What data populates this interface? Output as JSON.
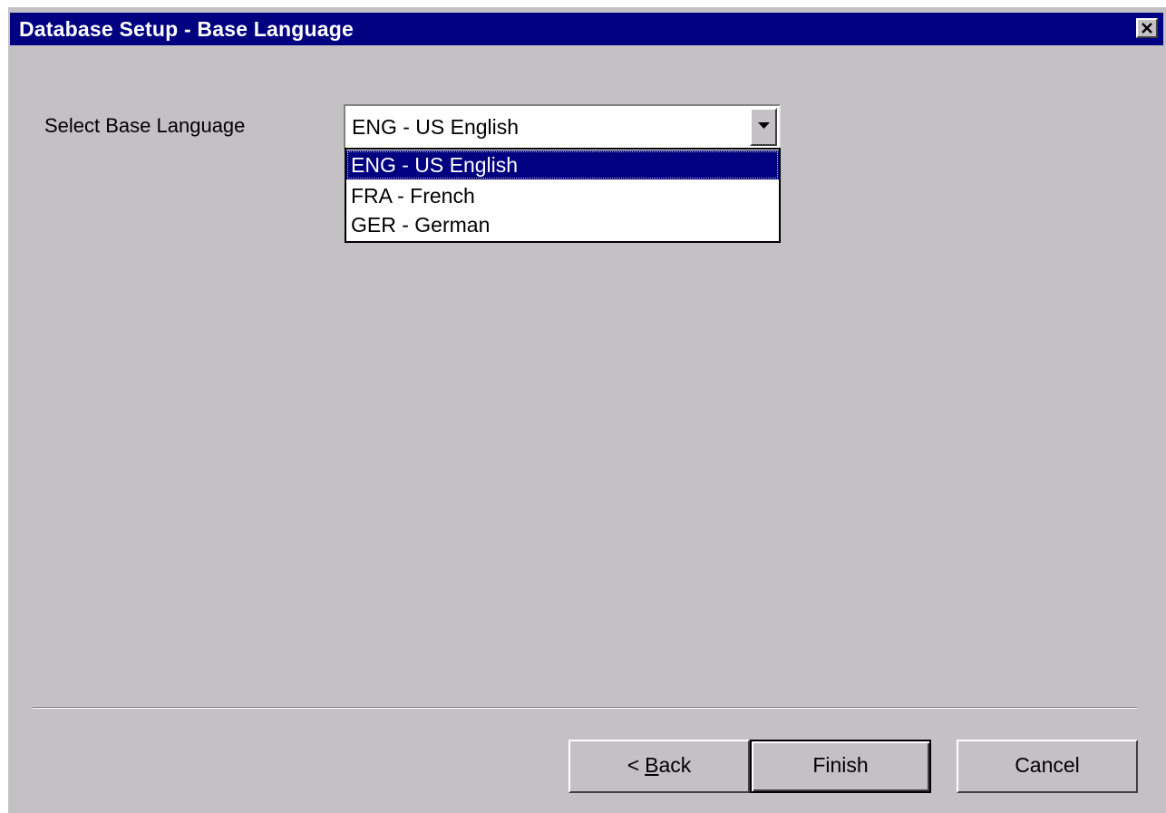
{
  "window": {
    "title": "Database Setup - Base Language",
    "close_icon": "close-icon"
  },
  "form": {
    "language_label": "Select Base Language",
    "language_combo": {
      "selected_value": "ENG - US English",
      "options": [
        "ENG - US English",
        "FRA - French",
        "GER - German"
      ],
      "highlighted_index": 0,
      "expanded": true
    }
  },
  "buttons": {
    "back_prefix": "<",
    "back_mnemonic": "B",
    "back_rest": "ack",
    "finish_label": "Finish",
    "cancel_label": "Cancel"
  },
  "colors": {
    "titlebar": "#000080",
    "face": "#c4c1c5",
    "highlight": "#000080"
  }
}
